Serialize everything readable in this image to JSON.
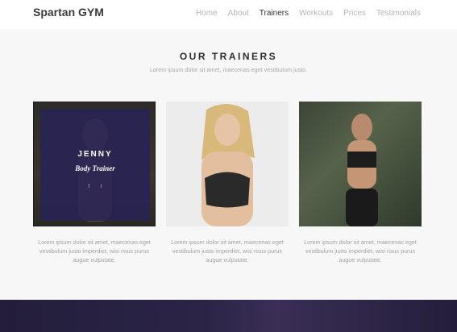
{
  "navbar": {
    "brand": "Spartan GYM",
    "links": [
      {
        "label": "Home",
        "active": false
      },
      {
        "label": "About",
        "active": false
      },
      {
        "label": "Trainers",
        "active": true
      },
      {
        "label": "Workouts",
        "active": false
      },
      {
        "label": "Prices",
        "active": false
      },
      {
        "label": "Testimonials",
        "active": false
      }
    ]
  },
  "section": {
    "title": "OUR TRAINERS",
    "subtitle": "Lorem ipsum dolor sit amet, maecenas eget vestibulum justo."
  },
  "trainers": [
    {
      "name": "JENNY",
      "role": "Body Trainer",
      "social": [
        "facebook-icon",
        "twitter-icon"
      ],
      "social_glyphs": [
        "f",
        "t"
      ],
      "description": "Lorem ipsum dolor sit amet, maecenas eget vestibulum justo imperdiet, wisi risus purus augue vulputate."
    },
    {
      "description": "Lorem ipsum dolor sit amet, maecenas eget vestibulum justo imperdiet, wisi risus purus augue vulputate."
    },
    {
      "description": "Lorem ipsum dolor sit amet, maecenas eget vestibulum justo imperdiet, wisi risus purus augue vulputate."
    }
  ],
  "colors": {
    "overlay": "#282355",
    "footer": "#241e3c",
    "nav_active": "#333333",
    "nav_inactive": "#b5b5b5"
  }
}
